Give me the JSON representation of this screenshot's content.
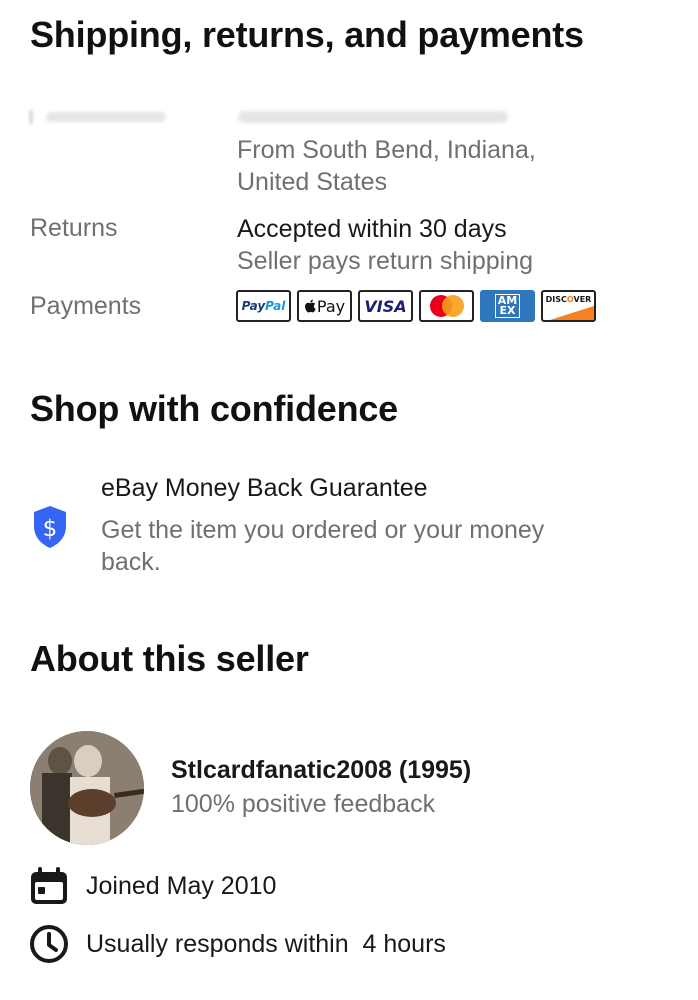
{
  "shipping_section": {
    "title": "Shipping, returns, and payments",
    "origin_line1": "From South Bend, Indiana,",
    "origin_line2": "United States",
    "returns_label": "Returns",
    "returns_primary": "Accepted within 30 days",
    "returns_secondary": "Seller pays return shipping",
    "payments_label": "Payments",
    "payment_methods": [
      {
        "name": "PayPal",
        "icon": "paypal-logo"
      },
      {
        "name": "Apple Pay",
        "icon": "apple-pay-logo"
      },
      {
        "name": "VISA",
        "icon": "visa-logo"
      },
      {
        "name": "Mastercard",
        "icon": "mastercard-logo"
      },
      {
        "name": "AMEX",
        "icon": "amex-logo"
      },
      {
        "name": "DISCOVER",
        "icon": "discover-logo"
      }
    ]
  },
  "confidence_section": {
    "title": "Shop with confidence",
    "guarantee_title": "eBay Money Back Guarantee",
    "guarantee_text": "Get the item you ordered or your money back.",
    "icon": "shield-dollar-icon",
    "icon_color": "#3665f3"
  },
  "seller_section": {
    "title": "About this seller",
    "seller_name": "Stlcardfanatic2008 (1995)",
    "feedback": "100% positive feedback",
    "joined": "Joined May 2010",
    "response": "Usually responds within  4 hours"
  },
  "colors": {
    "text_primary": "#191919",
    "text_secondary": "#707070",
    "accent": "#3665f3"
  }
}
